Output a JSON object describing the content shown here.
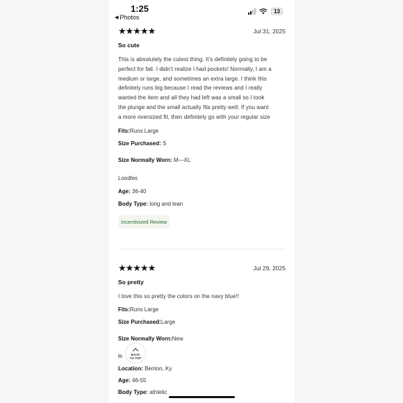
{
  "status_bar": {
    "time": "1:25",
    "battery": "13",
    "back_label": "Photos"
  },
  "reviews": [
    {
      "stars": "★★★★★",
      "date": "Jul 31, 2025",
      "title": "So cute",
      "body_lines": [
        "This is absolutely the cutest thing. It’s definitely going to be",
        "perfect for fall. I didn’t realize I had pockets! Normally, I am a",
        "medium or large, and sometimes an extra large. I think this",
        "definitely runs big because I read the reviews and I really",
        "wanted the item and all they had left was a small so I took",
        "the plunge and the small actually fits pretty well. If you want",
        "a more oversized fit, then definitely go with your regular size"
      ],
      "fits_label": "Fits:",
      "fits_value": "Runs Large",
      "size_purchased_label": "Size Purchased:",
      "size_purchased_value": "S",
      "size_worn_label": "Size Normally Worn:",
      "size_worn_value": "M—XL",
      "reviewer": "Loodles",
      "age_label": "Age:",
      "age_value": "36-40",
      "body_type_label": "Body Type:",
      "body_type_value": "long and lean",
      "badge": "Incentivized Review"
    },
    {
      "stars": "★★★★★",
      "date": "Jul 29, 2025",
      "title": "So pretty",
      "body_lines": [
        "I love this so pretty the colors on the navy blue!!"
      ],
      "fits_label": "Fits:",
      "fits_value": "Runs Large",
      "size_purchased_label": "Size Purchased:",
      "size_purchased_value": "Large",
      "size_worn_label": "Size Normally Worn:",
      "size_worn_value": "New",
      "reviewer": "le",
      "location_label": "Location:",
      "location_value": "Benton, Ky",
      "age_label": "Age:",
      "age_value": "46-55",
      "body_type_label": "Body Type:",
      "body_type_value": "athletic"
    }
  ],
  "back_to_top": {
    "line1": "BACK",
    "line2": "TO TOP"
  },
  "colors": {
    "badge_text": "#2e6d3a",
    "badge_bg": "#f3f5ef",
    "stars": "#111111"
  }
}
